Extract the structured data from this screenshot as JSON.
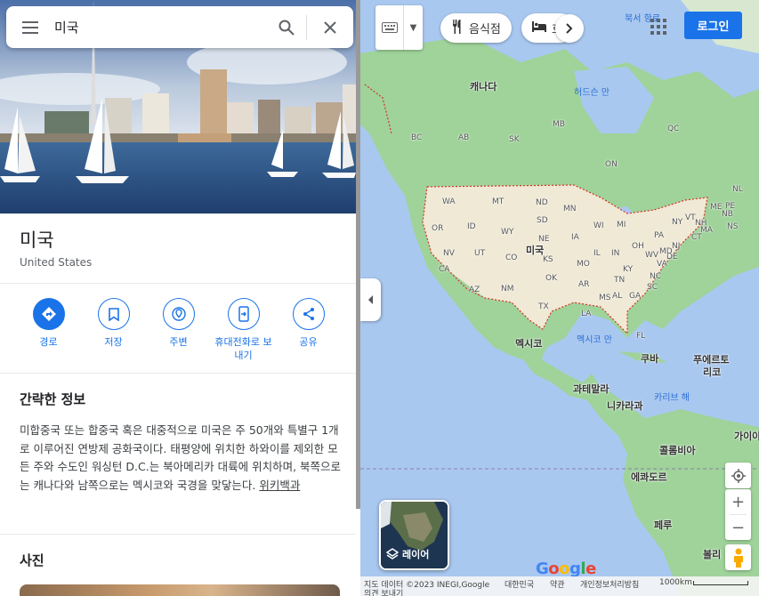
{
  "search": {
    "value": "미국"
  },
  "place": {
    "title": "미국",
    "subtitle": "United States"
  },
  "actions": [
    {
      "label": "경로",
      "icon": "directions-icon"
    },
    {
      "label": "저장",
      "icon": "bookmark-icon"
    },
    {
      "label": "주변",
      "icon": "nearby-icon"
    },
    {
      "label": "휴대전화로 보내기",
      "icon": "send-to-phone-icon"
    },
    {
      "label": "공유",
      "icon": "share-icon"
    }
  ],
  "summary": {
    "title": "간략한 정보",
    "text": "미합중국 또는 합중국 혹은 대중적으로 미국은 주 50개와 특별구 1개로 이루어진 연방제 공화국이다. 태평양에 위치한 하와이를 제외한 모든 주와 수도인 워싱턴 D.C.는 북아메리카 대륙에 위치하며, 북쪽으로는 캐나다와 남쪽으로는 멕시코와 국경을 맞닿는다. ",
    "source": "위키백과"
  },
  "photos": {
    "title": "사진"
  },
  "map": {
    "chips": [
      {
        "label": "음식점",
        "icon": "restaurant-icon"
      },
      {
        "label": "호",
        "icon": "hotel-icon"
      }
    ],
    "login": "로그인",
    "layers": "레이어",
    "labels": {
      "canada": "캐나다",
      "usa": "미국",
      "mexico": "멕시코",
      "cuba": "쿠바",
      "puerto_rico_1": "푸에르토",
      "puerto_rico_2": "리코",
      "guatemala": "과테말라",
      "nicaragua": "니카라과",
      "colombia": "콜롬비아",
      "ecuador": "에콰도르",
      "peru": "페루",
      "bolivia": "볼리",
      "guyana": "가이아",
      "hudson_bay": "허드슨 만",
      "gulf_mexico": "멕시코 만",
      "caribbean": "카리브 해",
      "north_pole": "북서 항로",
      "prov": [
        "BC",
        "AB",
        "SK",
        "MB",
        "ON",
        "QC",
        "NB",
        "NL",
        "NS",
        "PE"
      ],
      "states": [
        "WA",
        "MT",
        "ND",
        "MN",
        "OR",
        "ID",
        "WY",
        "SD",
        "WI",
        "MI",
        "NV",
        "UT",
        "NE",
        "IA",
        "IL",
        "IN",
        "OH",
        "PA",
        "NY",
        "CA",
        "AZ",
        "CO",
        "KS",
        "MO",
        "KY",
        "WV",
        "VA",
        "NM",
        "OK",
        "AR",
        "TN",
        "NC",
        "TX",
        "LA",
        "MS",
        "AL",
        "GA",
        "SC",
        "FL",
        "ME",
        "VT",
        "NH",
        "MA",
        "CT",
        "NJ",
        "DE",
        "MD"
      ]
    },
    "footer": {
      "data": "지도 데이터 ©2023 INEGI,Google",
      "country": "대한민국",
      "terms": "약관",
      "privacy": "개인정보처리방침",
      "feedback": "의견 보내기",
      "scale": "1000km"
    },
    "colors": {
      "land": "#a8d8a0",
      "usa": "#f0ebd9",
      "water": "#a9c8f0",
      "border": "#d93025"
    }
  }
}
